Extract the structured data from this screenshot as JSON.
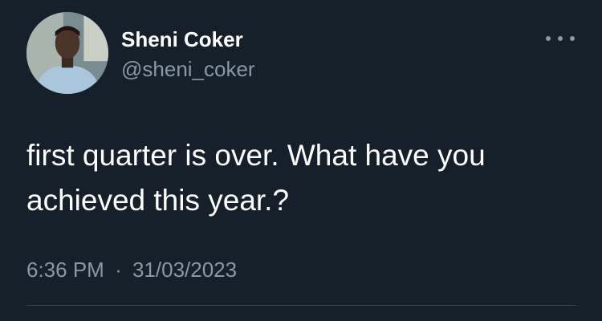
{
  "user": {
    "display_name": "Sheni Coker",
    "handle": "@sheni_coker"
  },
  "tweet": {
    "text": "first quarter is over. What have you achieved this year.?",
    "time": "6:36 PM",
    "separator": "·",
    "date": "31/03/2023"
  },
  "icons": {
    "more": "more-options-icon"
  },
  "colors": {
    "background": "#15202b",
    "primary_text": "#ffffff",
    "secondary_text": "#8899a6",
    "divider": "#38444d"
  }
}
